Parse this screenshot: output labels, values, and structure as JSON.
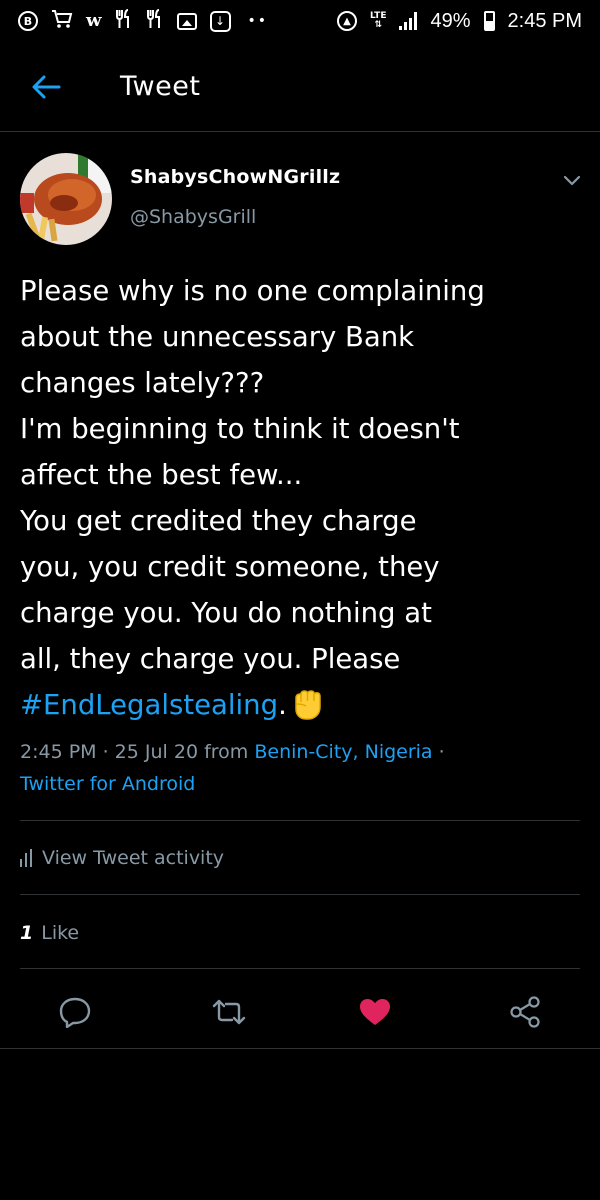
{
  "status_bar": {
    "left_icons": [
      "b-circle-icon",
      "shopping-cart-icon",
      "w-icon",
      "fork-knife-icon",
      "fork-knife-icon",
      "gallery-icon",
      "download-icon",
      "more-dots-icon"
    ],
    "battery": "49%",
    "time": "2:45 PM",
    "network": "LTE"
  },
  "header": {
    "title": "Tweet"
  },
  "tweet": {
    "author": {
      "display_name": "ShabysChowNGrillz",
      "handle": "@ShabysGrill"
    },
    "text_lines": [
      "Please why is no one complaining",
      "about the unnecessary Bank",
      "changes lately???",
      "I'm beginning to think it doesn't",
      "affect the best few...",
      "You get credited they charge",
      "you, you credit someone, they",
      "charge you. You do nothing at",
      "all, they charge you. Please"
    ],
    "hashtag": "#EndLegalstealing",
    "hashtag_suffix": ".",
    "emoji": "raised-fist",
    "timestamp": "2:45 PM · 25 Jul 20 from",
    "location": "Benin-City, Nigeria",
    "separator": "·",
    "source": "Twitter for Android"
  },
  "activity": {
    "label": "View Tweet activity"
  },
  "engagement": {
    "like_count": "1",
    "like_label": "Like"
  },
  "actions": [
    "reply-icon",
    "retweet-icon",
    "like-icon",
    "share-icon"
  ],
  "colors": {
    "background": "#000000",
    "accent": "#1da1f2",
    "secondary_text": "#8899a6",
    "like": "#e0245e",
    "divider": "#2f3336"
  }
}
